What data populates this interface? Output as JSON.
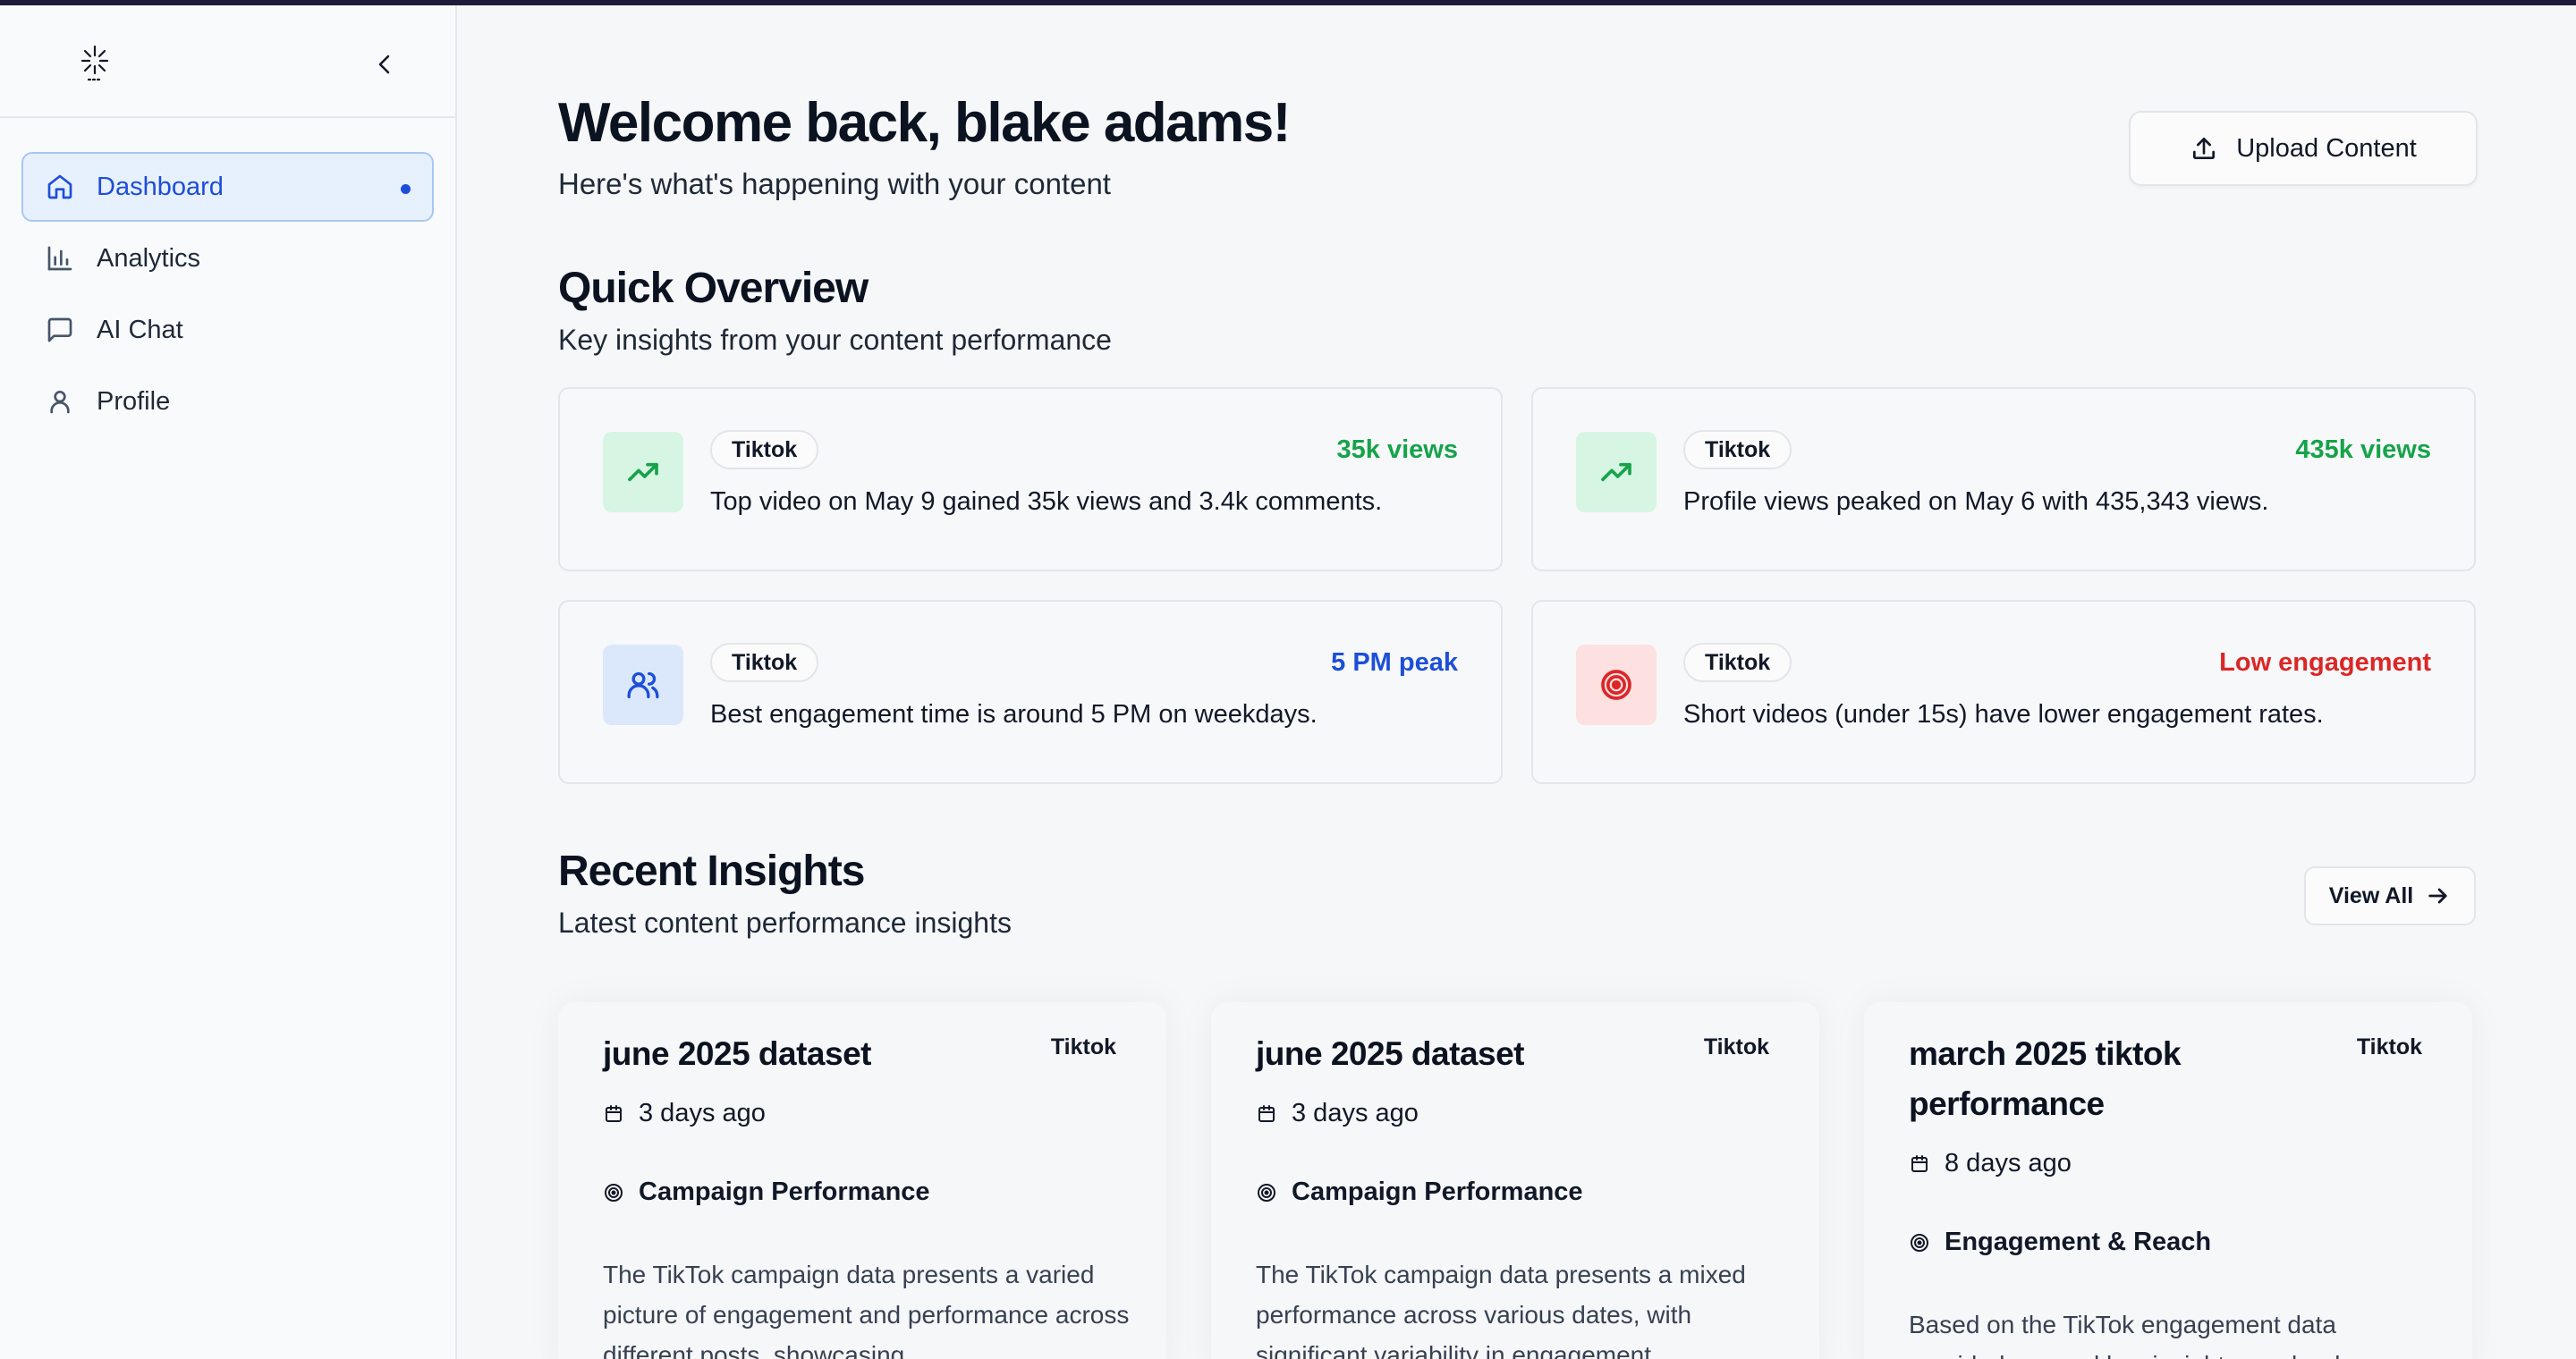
{
  "sidebar": {
    "items": [
      {
        "label": "Dashboard",
        "icon": "home-icon",
        "active": true
      },
      {
        "label": "Analytics",
        "icon": "bar-chart-icon"
      },
      {
        "label": "AI Chat",
        "icon": "message-square-icon"
      },
      {
        "label": "Profile",
        "icon": "user-icon"
      }
    ]
  },
  "header": {
    "welcome": "Welcome back, blake adams!",
    "subtitle": "Here's what's happening with your content",
    "upload_label": "Upload Content"
  },
  "overview": {
    "title": "Quick Overview",
    "subtitle": "Key insights from your content performance",
    "cards": [
      {
        "platform": "Tiktok",
        "metric": "35k views",
        "text": "Top video on May 9 gained 35k views and 3.4k comments.",
        "icon": "trending-up-icon",
        "tone": "#16a34a"
      },
      {
        "platform": "Tiktok",
        "metric": "435k views",
        "text": "Profile views peaked on May 6 with 435,343 views.",
        "icon": "trending-up-icon",
        "tone": "#16a34a"
      },
      {
        "platform": "Tiktok",
        "metric": "5 PM peak",
        "text": "Best engagement time is around 5 PM on weekdays.",
        "icon": "users-icon",
        "tone": "#1d4ed8"
      },
      {
        "platform": "Tiktok",
        "metric": "Low engagement",
        "text": "Short videos (under 15s) have lower engagement rates.",
        "icon": "target-icon",
        "tone": "#dc2626"
      }
    ]
  },
  "insights": {
    "title": "Recent Insights",
    "subtitle": "Latest content performance insights",
    "view_all_label": "View All",
    "cards": [
      {
        "title": "june 2025 dataset",
        "platform": "Tiktok",
        "date": "3 days ago",
        "category": "Campaign Performance",
        "body": "The TikTok campaign data presents a varied picture of engagement and performance across different posts, showcasing..."
      },
      {
        "title": "june 2025 dataset",
        "platform": "Tiktok",
        "date": "3 days ago",
        "category": "Campaign Performance",
        "body": "The TikTok campaign data presents a mixed performance across various dates, with significant variability in engagement..."
      },
      {
        "title": "march 2025 tiktok performance",
        "platform": "Tiktok",
        "date": "8 days ago",
        "category": "Engagement & Reach",
        "body": "Based on the TikTok engagement data provided, several key insights can be drawn..."
      }
    ]
  }
}
